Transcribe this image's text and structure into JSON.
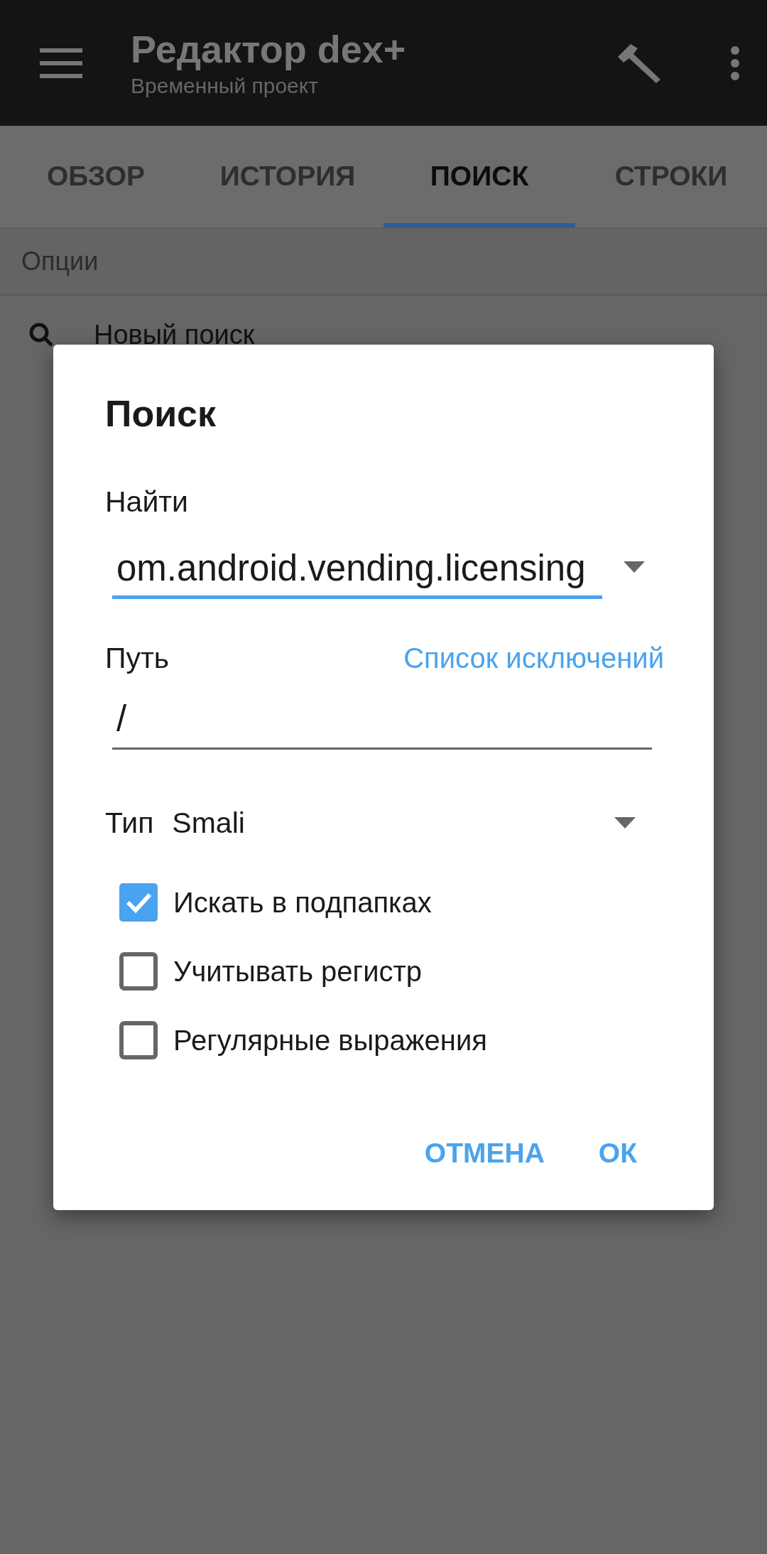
{
  "app_bar": {
    "title": "Редактор dex+",
    "subtitle": "Временный проект"
  },
  "tabs": [
    {
      "label": "ОБЗОР",
      "selected": false
    },
    {
      "label": "ИСТОРИЯ",
      "selected": false
    },
    {
      "label": "ПОИСК",
      "selected": true
    },
    {
      "label": "СТРОКИ",
      "selected": false
    }
  ],
  "section_header": "Опции",
  "list_items": [
    {
      "label": "Новый поиск"
    }
  ],
  "dialog": {
    "title": "Поиск",
    "find_label": "Найти",
    "find_field": {
      "value": "om.android.vending.licensing",
      "focused": true
    },
    "path_label": "Путь",
    "exclusions_link": "Список исключений",
    "path_field": {
      "value": "/",
      "focused": false
    },
    "type_label": "Тип",
    "type_value": "Smali",
    "options": [
      {
        "label": "Искать в подпапках",
        "checked": true
      },
      {
        "label": "Учитывать регистр",
        "checked": false
      },
      {
        "label": "Регулярные выражения",
        "checked": false
      }
    ],
    "buttons": [
      {
        "label": "ОТМЕНА"
      },
      {
        "label": "ОК"
      }
    ]
  }
}
